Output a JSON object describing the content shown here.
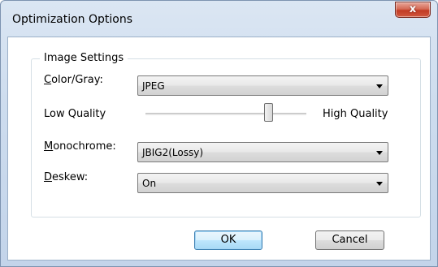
{
  "window": {
    "title": "Optimization Options",
    "close_glyph": "x"
  },
  "group": {
    "title": "Image Settings"
  },
  "color_gray": {
    "label_accel": "C",
    "label_rest": "olor/Gray:",
    "value": "JPEG"
  },
  "quality": {
    "low_label": "Low Quality",
    "high_label": "High Quality",
    "level": 0.78
  },
  "monochrome": {
    "label_accel": "M",
    "label_rest": "onochrome:",
    "value": "JBIG2(Lossy)"
  },
  "deskew": {
    "label_accel": "D",
    "label_rest": "eskew:",
    "value": "On"
  },
  "buttons": {
    "ok": "OK",
    "cancel": "Cancel"
  },
  "colors": {
    "default_button_border": "#3c7fb1",
    "close_button": "#c23b24"
  }
}
